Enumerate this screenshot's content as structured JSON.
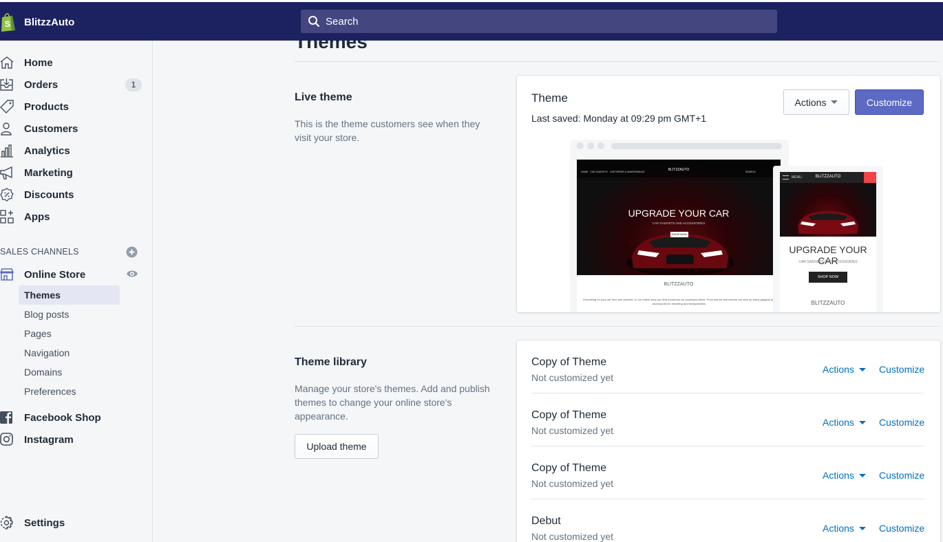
{
  "topbar": {
    "store_name": "BlitzzAuto",
    "search_placeholder": "Search",
    "colors": {
      "bar": "#1c2260",
      "search": "#43467f"
    }
  },
  "sidebar": {
    "items": [
      {
        "label": "Home",
        "icon": "home-icon"
      },
      {
        "label": "Orders",
        "icon": "orders-icon",
        "badge": "1"
      },
      {
        "label": "Products",
        "icon": "tag-icon"
      },
      {
        "label": "Customers",
        "icon": "person-icon"
      },
      {
        "label": "Analytics",
        "icon": "bar-chart-icon"
      },
      {
        "label": "Marketing",
        "icon": "megaphone-icon"
      },
      {
        "label": "Discounts",
        "icon": "discount-icon"
      },
      {
        "label": "Apps",
        "icon": "apps-icon"
      }
    ],
    "sales_channels_label": "SALES CHANNELS",
    "online_store": {
      "label": "Online Store",
      "icon": "store-icon"
    },
    "online_store_subitems": [
      "Themes",
      "Blog posts",
      "Pages",
      "Navigation",
      "Domains",
      "Preferences"
    ],
    "active_subitem": "Themes",
    "channels": [
      {
        "label": "Facebook Shop",
        "icon": "facebook-icon"
      },
      {
        "label": "Instagram",
        "icon": "instagram-icon"
      }
    ],
    "settings": {
      "label": "Settings",
      "icon": "gear-icon"
    }
  },
  "main": {
    "page_title": "Themes",
    "live_theme": {
      "title": "Live theme",
      "description": "This is the theme customers see when they visit your store.",
      "card": {
        "theme_name": "Theme",
        "last_saved": "Last saved: Monday at 09:29 pm GMT+1",
        "actions_label": "Actions",
        "customize_label": "Customize"
      },
      "preview": {
        "desktop": {
          "headline": "UPGRADE YOUR CAR",
          "subheadline": "CAR GADGETS AND ACCESSORIES",
          "button": "SHOP NOW",
          "logo": "BLITZZAUTO",
          "nav": "HOME   CAR GADGETS   CAR REPAIR & MAINTENANCE",
          "search": "SEARCH",
          "body_text": "Everything for your car from one provider. In our online shop you find numerous car accessory items. From interior and exterior car care up many gadgets and accessories for travelling and transportation."
        },
        "mobile": {
          "menu": "MENU",
          "logo": "BLITZZAUTO",
          "headline": "UPGRADE YOUR CAR",
          "subheadline": "CAR GADGETS AND ACCESSORIES",
          "button": "SHOP NOW",
          "footer_logo": "BLITZZAUTO"
        }
      }
    },
    "theme_library": {
      "title": "Theme library",
      "description": "Manage your store's themes. Add and publish themes to change your online store's appearance.",
      "upload_label": "Upload theme",
      "themes": [
        {
          "name": "Copy of Theme",
          "status": "Not customized yet",
          "actions": "Actions",
          "customize": "Customize"
        },
        {
          "name": "Copy of Theme",
          "status": "Not customized yet",
          "actions": "Actions",
          "customize": "Customize"
        },
        {
          "name": "Copy of Theme",
          "status": "Not customized yet",
          "actions": "Actions",
          "customize": "Customize"
        },
        {
          "name": "Debut",
          "status": "Not customized yet",
          "actions": "Actions",
          "customize": "Customize"
        }
      ]
    }
  }
}
